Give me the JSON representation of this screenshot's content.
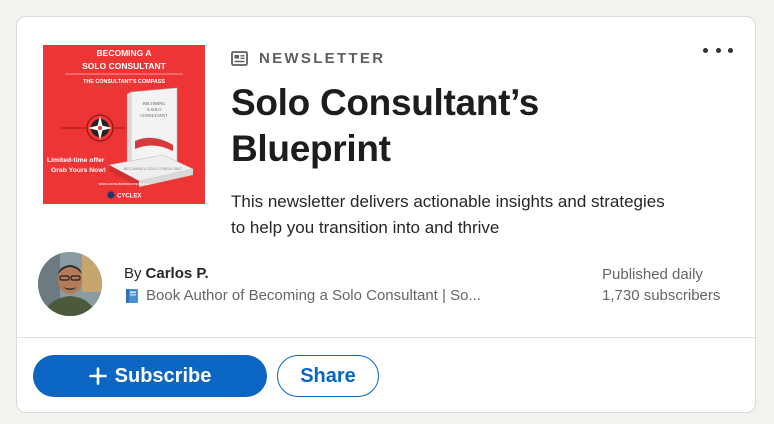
{
  "cover": {
    "heading_line1": "BECOMING A",
    "heading_line2": "SOLO CONSULTANT",
    "subheading": "THE CONSULTANT'S COMPASS",
    "offer_line1": "Limited-time offer",
    "offer_line2": "Grab Yours Now!",
    "website": "www.consultantscompass.co",
    "brand": "CYCLEX",
    "book_cover_title": "BECOMING A SOLO CONSULTANT",
    "background_color": "#ee3535"
  },
  "newsletter": {
    "tag_label": "NEWSLETTER",
    "tag_icon": "newspaper-icon",
    "title_line1": "Solo Consultant’s",
    "title_line2": "Blueprint",
    "description_line1": "This newsletter delivers actionable insights and strategies",
    "description_line2": "to help you transition into and thrive"
  },
  "author": {
    "by_prefix": "By",
    "name": "Carlos P.",
    "headline_icon": "book-icon",
    "headline": "Book Author of Becoming a Solo Consultant | So..."
  },
  "meta": {
    "frequency": "Published daily",
    "subscribers": "1,730 subscribers"
  },
  "actions": {
    "subscribe_label": "Subscribe",
    "share_label": "Share",
    "more_icon": "more-options-icon"
  },
  "colors": {
    "accent": "#0a66c2",
    "page_background": "#f4f2ee",
    "card_background": "#ffffff"
  }
}
